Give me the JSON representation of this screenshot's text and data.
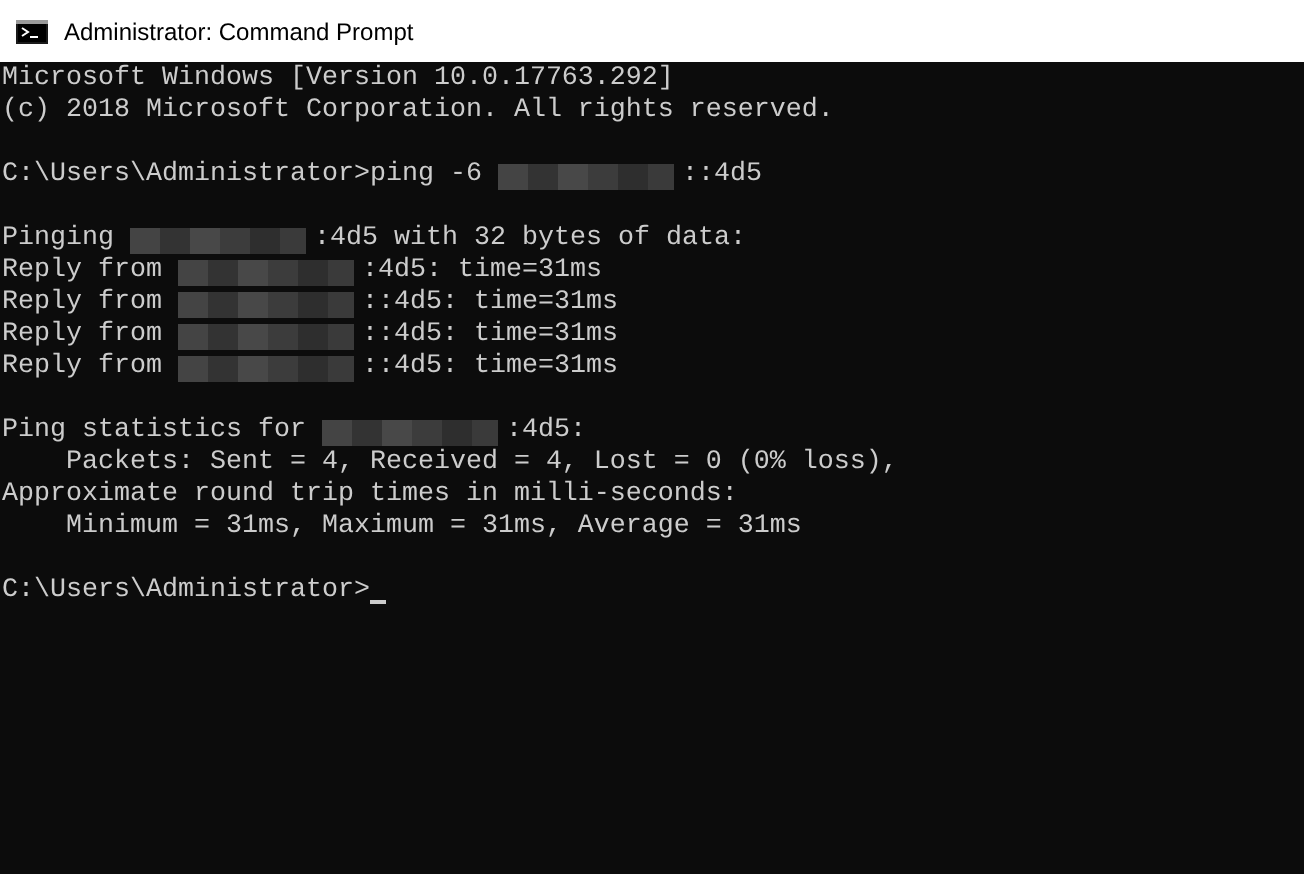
{
  "window": {
    "title": "Administrator: Command Prompt"
  },
  "console": {
    "lines": [
      {
        "kind": "text",
        "segments": [
          {
            "kind": "text",
            "text": "Microsoft Windows [Version 10.0.17763.292]"
          }
        ]
      },
      {
        "kind": "text",
        "segments": [
          {
            "kind": "text",
            "text": "(c) 2018 Microsoft Corporation. All rights reserved."
          }
        ]
      },
      {
        "kind": "blank"
      },
      {
        "kind": "text",
        "segments": [
          {
            "kind": "text",
            "text": "C:\\Users\\Administrator>ping -6"
          },
          {
            "kind": "redacted"
          },
          {
            "kind": "text",
            "text": "::4d5"
          }
        ]
      },
      {
        "kind": "blank"
      },
      {
        "kind": "text",
        "segments": [
          {
            "kind": "text",
            "text": "Pinging"
          },
          {
            "kind": "redacted"
          },
          {
            "kind": "text",
            "text": ":4d5 with 32 bytes of data:"
          }
        ]
      },
      {
        "kind": "text",
        "segments": [
          {
            "kind": "text",
            "text": "Reply from"
          },
          {
            "kind": "redacted"
          },
          {
            "kind": "text",
            "text": ":4d5: time=31ms"
          }
        ]
      },
      {
        "kind": "text",
        "segments": [
          {
            "kind": "text",
            "text": "Reply from"
          },
          {
            "kind": "redacted"
          },
          {
            "kind": "text",
            "text": "::4d5: time=31ms"
          }
        ]
      },
      {
        "kind": "text",
        "segments": [
          {
            "kind": "text",
            "text": "Reply from"
          },
          {
            "kind": "redacted"
          },
          {
            "kind": "text",
            "text": "::4d5: time=31ms"
          }
        ]
      },
      {
        "kind": "text",
        "segments": [
          {
            "kind": "text",
            "text": "Reply from"
          },
          {
            "kind": "redacted"
          },
          {
            "kind": "text",
            "text": "::4d5: time=31ms"
          }
        ]
      },
      {
        "kind": "blank"
      },
      {
        "kind": "text",
        "segments": [
          {
            "kind": "text",
            "text": "Ping statistics for"
          },
          {
            "kind": "redacted"
          },
          {
            "kind": "text",
            "text": ":4d5:"
          }
        ]
      },
      {
        "kind": "text",
        "segments": [
          {
            "kind": "text",
            "text": "    Packets: Sent = 4, Received = 4, Lost = 0 (0% loss),"
          }
        ]
      },
      {
        "kind": "text",
        "segments": [
          {
            "kind": "text",
            "text": "Approximate round trip times in milli-seconds:"
          }
        ]
      },
      {
        "kind": "text",
        "segments": [
          {
            "kind": "text",
            "text": "    Minimum = 31ms, Maximum = 31ms, Average = 31ms"
          }
        ]
      },
      {
        "kind": "blank"
      },
      {
        "kind": "text",
        "segments": [
          {
            "kind": "text",
            "text": "C:\\Users\\Administrator>"
          },
          {
            "kind": "cursor"
          }
        ]
      }
    ]
  }
}
